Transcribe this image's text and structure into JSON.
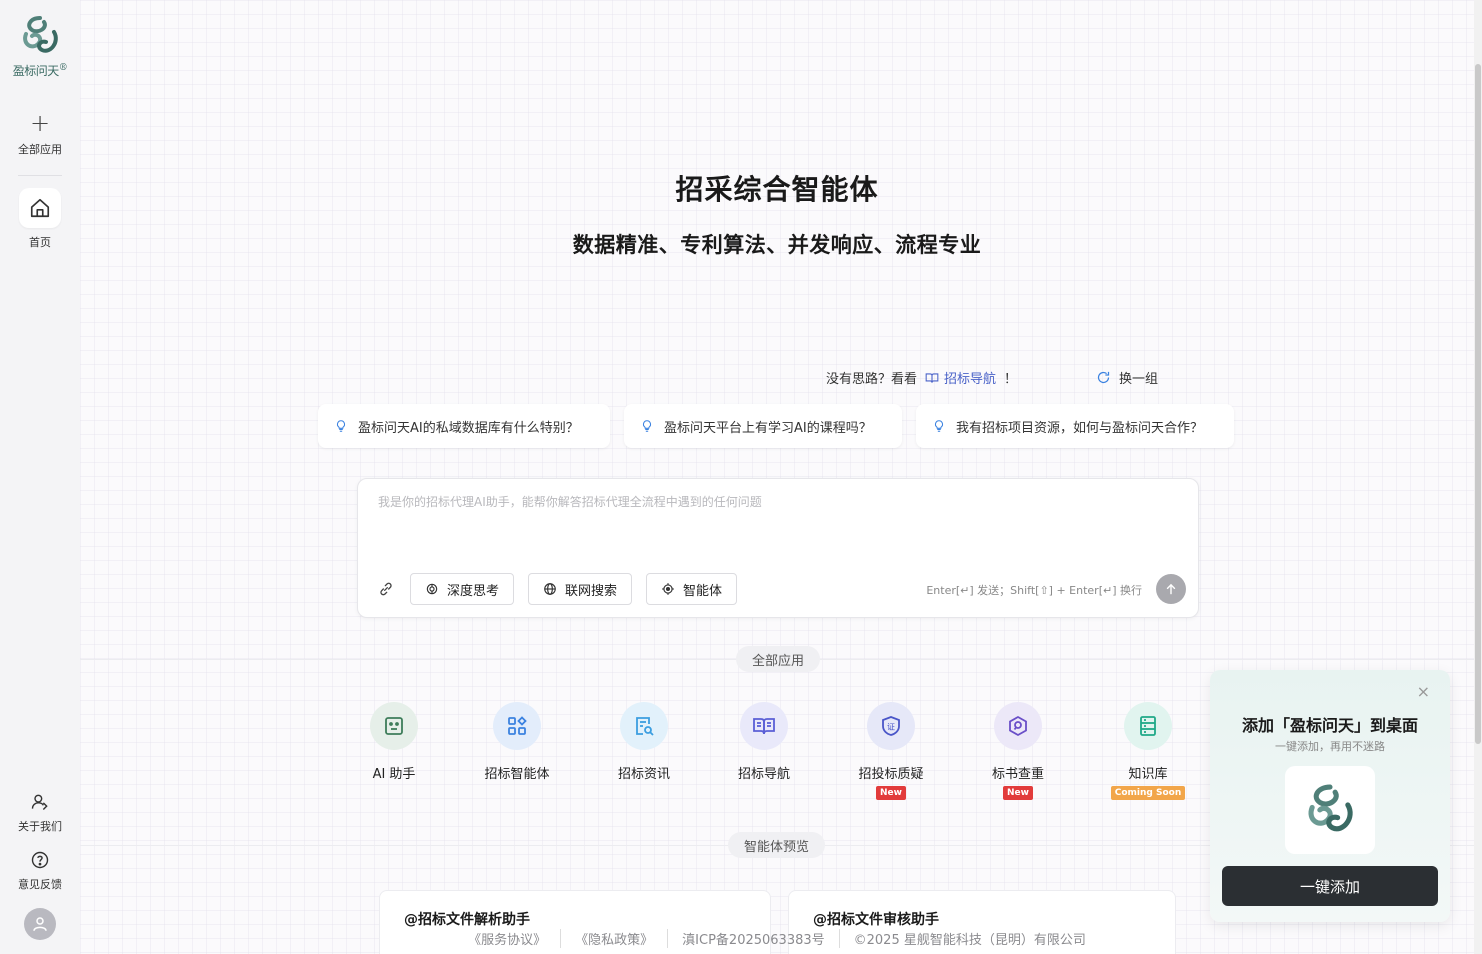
{
  "brand": {
    "name": "盈标问天",
    "reg_mark": "®"
  },
  "sidebar": {
    "all_apps": "全部应用",
    "home": "首页",
    "about": "关于我们",
    "feedback": "意见反馈"
  },
  "hero": {
    "title": "招采综合智能体",
    "subtitle": "数据精准、专利算法、并发响应、流程专业"
  },
  "hint": {
    "prefix": "没有思路？看看",
    "link": "招标导航",
    "suffix": "！",
    "refresh": "换一组"
  },
  "suggestions": [
    "盈标问天AI的私域数据库有什么特别？",
    "盈标问天平台上有学习AI的课程吗？",
    "我有招标项目资源，如何与盈标问天合作？"
  ],
  "chat": {
    "placeholder": "我是你的招标代理AI助手，能帮你解答招标代理全流程中遇到的任何问题",
    "tools": [
      "深度思考",
      "联网搜索",
      "智能体"
    ],
    "send_hint": "Enter[↵] 发送；Shift[⇧] + Enter[↵] 换行"
  },
  "sections": {
    "apps": "全部应用",
    "agents": "智能体预览"
  },
  "apps": [
    {
      "name": "AI 助手",
      "icon": "robot-icon",
      "color": "#3e7d5a",
      "bg": "#e6efe9"
    },
    {
      "name": "招标智能体",
      "icon": "grid-icon",
      "color": "#3b82e0",
      "bg": "#e3edfb"
    },
    {
      "name": "招标资讯",
      "icon": "doc-search-icon",
      "color": "#3b9ee0",
      "bg": "#e2f1fb"
    },
    {
      "name": "招标导航",
      "icon": "book-icon",
      "color": "#5b5fd6",
      "bg": "#e9e9fa"
    },
    {
      "name": "招投标质疑",
      "icon": "shield-icon",
      "color": "#4a56c8",
      "bg": "#e6e8f8",
      "badge": "New"
    },
    {
      "name": "标书查重",
      "icon": "search-badge-icon",
      "color": "#6a4fc8",
      "bg": "#ece8f8",
      "badge": "New"
    },
    {
      "name": "知识库",
      "icon": "database-icon",
      "color": "#1fa888",
      "bg": "#e1f4ef",
      "badge": "Coming Soon"
    }
  ],
  "agent_cards": [
    "@招标文件解析助手",
    "@招标文件审核助手"
  ],
  "footer": [
    "《服务协议》",
    "《隐私政策》",
    "滇ICP备2025063383号",
    "©2025 星舰智能科技（昆明）有限公司"
  ],
  "popup": {
    "title": "添加「盈标问天」到桌面",
    "subtitle": "一键添加，再用不迷路",
    "button": "一键添加",
    "close": "×"
  }
}
